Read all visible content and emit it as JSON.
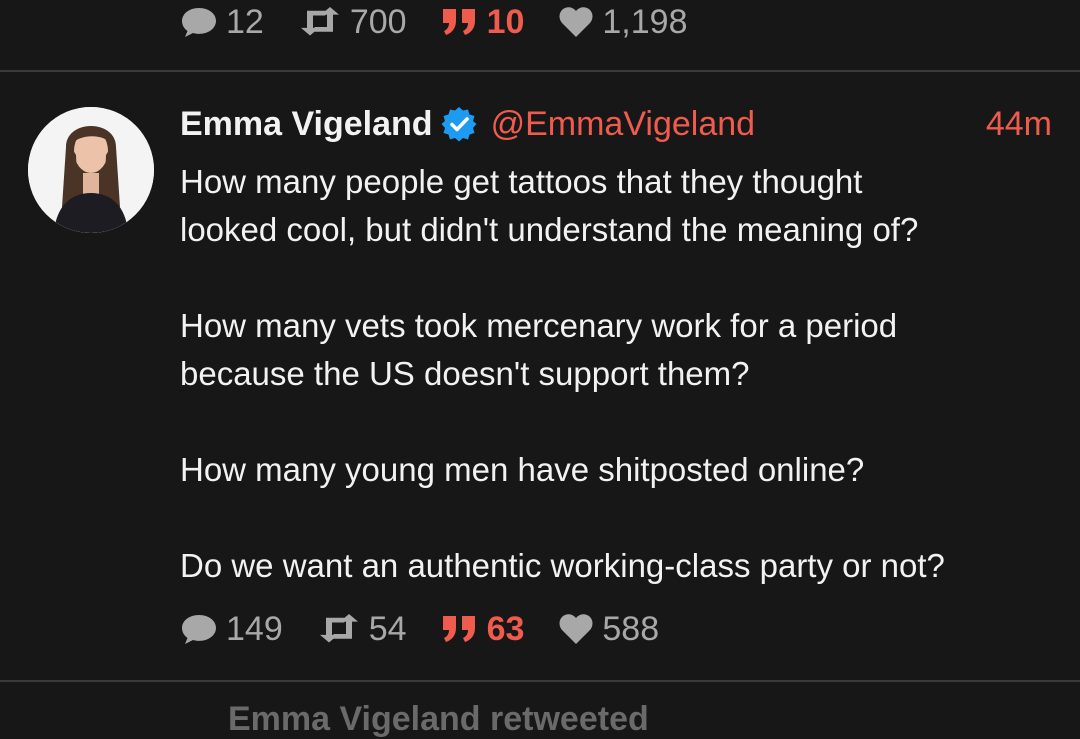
{
  "previous_tweet": {
    "stats": {
      "replies": "12",
      "retweets": "700",
      "quotes": "10",
      "likes": "1,198"
    }
  },
  "tweet": {
    "author_name": "Emma Vigeland",
    "handle": "@EmmaVigeland",
    "time": "44m",
    "verified": true,
    "paragraphs": [
      "How many people get tattoos that they thought\nlooked cool, but didn't understand the meaning of?",
      "How many vets took mercenary work for a period\nbecause the US doesn't support them?",
      "How many young men have shitposted online?",
      "Do we want an authentic working-class party or not?"
    ],
    "stats": {
      "replies": "149",
      "retweets": "54",
      "quotes": "63",
      "likes": "588"
    }
  },
  "next_item_peek": "Emma Vigeland retweeted",
  "colors": {
    "background": "#171717",
    "accent": "#ef5b4c",
    "verified": "#1d9bf0",
    "muted": "#a8a8a8",
    "divider": "#3a3a3a"
  },
  "icons": {
    "replies": "speech-bubble-icon",
    "retweets": "retweet-icon",
    "quotes": "quote-icon",
    "likes": "heart-icon",
    "verified": "verified-badge-icon"
  }
}
